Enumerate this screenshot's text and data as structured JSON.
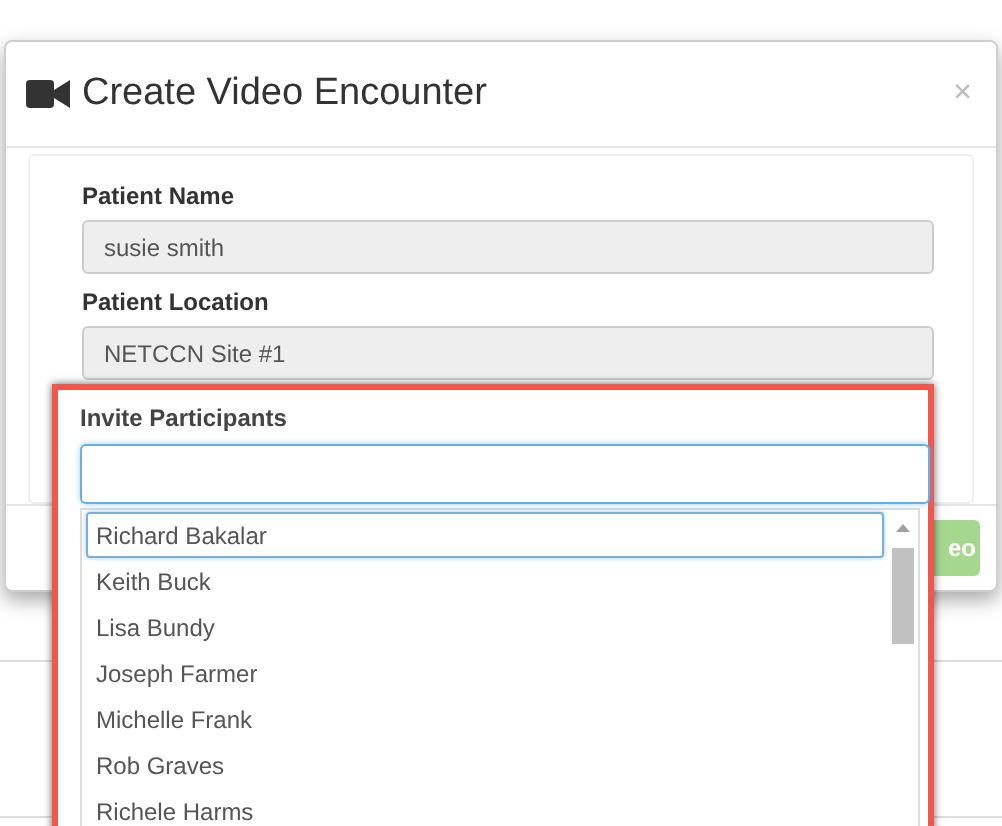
{
  "dialog": {
    "title": "Create Video Encounter",
    "close": "×"
  },
  "fields": [
    {
      "label": "Patient Name",
      "value": "susie smith",
      "disabled": true
    },
    {
      "label": "Patient Location",
      "value": "NETCCN Site #1",
      "disabled": true
    }
  ],
  "invite": {
    "label": "Invite Participants",
    "highlighted": true,
    "options": [
      {
        "name": "Richard Bakalar",
        "selected": true
      },
      {
        "name": "Keith Buck",
        "selected": false
      },
      {
        "name": "Lisa Bundy",
        "selected": false
      },
      {
        "name": "Joseph Farmer",
        "selected": false
      },
      {
        "name": "Michelle Frank",
        "selected": false
      },
      {
        "name": "Rob Graves",
        "selected": false
      },
      {
        "name": "Richele Harms",
        "selected": false
      }
    ]
  },
  "footer": {
    "button": "eo"
  }
}
